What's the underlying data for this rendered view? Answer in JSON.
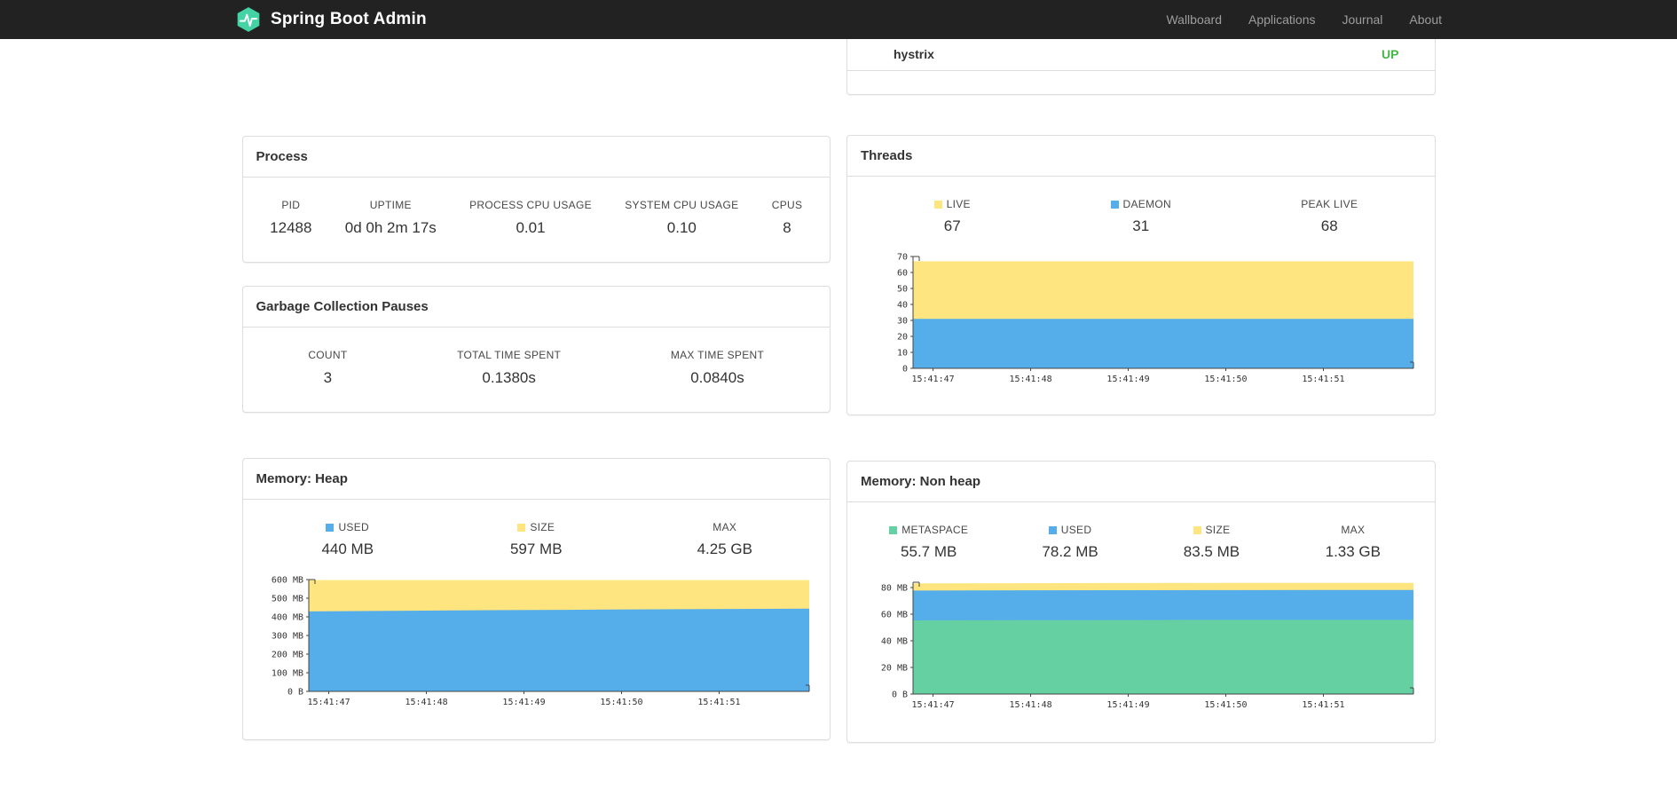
{
  "navbar": {
    "brand": "Spring Boot Admin",
    "links": [
      "Wallboard",
      "Applications",
      "Journal",
      "About"
    ]
  },
  "application": {
    "name": "hystrix",
    "status": "UP",
    "status_color": "#47b747"
  },
  "process": {
    "title": "Process",
    "metrics": [
      {
        "label": "PID",
        "value": "12488"
      },
      {
        "label": "UPTIME",
        "value": "0d 0h 2m 17s"
      },
      {
        "label": "PROCESS CPU USAGE",
        "value": "0.01"
      },
      {
        "label": "SYSTEM CPU USAGE",
        "value": "0.10"
      },
      {
        "label": "CPUS",
        "value": "8"
      }
    ]
  },
  "gc": {
    "title": "Garbage Collection Pauses",
    "metrics": [
      {
        "label": "COUNT",
        "value": "3"
      },
      {
        "label": "TOTAL TIME SPENT",
        "value": "0.1380s"
      },
      {
        "label": "MAX TIME SPENT",
        "value": "0.0840s"
      }
    ]
  },
  "threads": {
    "title": "Threads",
    "legend": [
      {
        "label": "LIVE",
        "value": "67",
        "color": "#ffe57f"
      },
      {
        "label": "DAEMON",
        "value": "31",
        "color": "#55aeea"
      },
      {
        "label": "PEAK LIVE",
        "value": "68"
      }
    ],
    "chart": {
      "type": "area",
      "ymax": 70,
      "yticks": [
        {
          "v": 0,
          "label": "0"
        },
        {
          "v": 10,
          "label": "10"
        },
        {
          "v": 20,
          "label": "20"
        },
        {
          "v": 30,
          "label": "30"
        },
        {
          "v": 40,
          "label": "40"
        },
        {
          "v": 50,
          "label": "50"
        },
        {
          "v": 60,
          "label": "60"
        },
        {
          "v": 70,
          "label": "70"
        }
      ],
      "xticks": [
        "15:41:47",
        "15:41:48",
        "15:41:49",
        "15:41:50",
        "15:41:51"
      ],
      "series": [
        {
          "name": "LIVE",
          "color": "#ffe57f",
          "values": [
            67,
            67,
            67,
            67,
            67,
            67
          ]
        },
        {
          "name": "DAEMON",
          "color": "#55aeea",
          "values": [
            31,
            31,
            31,
            31,
            31,
            31
          ]
        }
      ]
    }
  },
  "heap": {
    "title": "Memory: Heap",
    "legend": [
      {
        "label": "USED",
        "value": "440 MB",
        "color": "#55aeea"
      },
      {
        "label": "SIZE",
        "value": "597 MB",
        "color": "#ffe57f"
      },
      {
        "label": "MAX",
        "value": "4.25 GB"
      }
    ],
    "chart": {
      "type": "area",
      "ymax": 600,
      "yticks": [
        {
          "v": 0,
          "label": "0 B"
        },
        {
          "v": 100,
          "label": "100 MB"
        },
        {
          "v": 200,
          "label": "200 MB"
        },
        {
          "v": 300,
          "label": "300 MB"
        },
        {
          "v": 400,
          "label": "400 MB"
        },
        {
          "v": 500,
          "label": "500 MB"
        },
        {
          "v": 600,
          "label": "600 MB"
        }
      ],
      "xticks": [
        "15:41:47",
        "15:41:48",
        "15:41:49",
        "15:41:50",
        "15:41:51"
      ],
      "series": [
        {
          "name": "SIZE",
          "color": "#ffe57f",
          "values": [
            597,
            597,
            597,
            597,
            597,
            597
          ]
        },
        {
          "name": "USED",
          "color": "#55aeea",
          "values": [
            429,
            433,
            436,
            439,
            442,
            444
          ]
        }
      ]
    }
  },
  "nonheap": {
    "title": "Memory: Non heap",
    "legend": [
      {
        "label": "METASPACE",
        "value": "55.7 MB",
        "color": "#65d1a3"
      },
      {
        "label": "USED",
        "value": "78.2 MB",
        "color": "#55aeea"
      },
      {
        "label": "SIZE",
        "value": "83.5 MB",
        "color": "#ffe57f"
      },
      {
        "label": "MAX",
        "value": "1.33 GB"
      }
    ],
    "chart": {
      "type": "area",
      "ymax": 84,
      "yticks": [
        {
          "v": 0,
          "label": "0 B"
        },
        {
          "v": 20,
          "label": "20 MB"
        },
        {
          "v": 40,
          "label": "40 MB"
        },
        {
          "v": 60,
          "label": "60 MB"
        },
        {
          "v": 80,
          "label": "80 MB"
        }
      ],
      "xticks": [
        "15:41:47",
        "15:41:48",
        "15:41:49",
        "15:41:50",
        "15:41:51"
      ],
      "series": [
        {
          "name": "SIZE",
          "color": "#ffe57f",
          "values": [
            83.2,
            83.3,
            83.4,
            83.5,
            83.5,
            83.5
          ]
        },
        {
          "name": "USED",
          "color": "#55aeea",
          "values": [
            77.7,
            77.9,
            78.0,
            78.1,
            78.2,
            78.2
          ]
        },
        {
          "name": "METASPACE",
          "color": "#65d1a3",
          "values": [
            55.3,
            55.5,
            55.6,
            55.7,
            55.7,
            55.7
          ]
        }
      ]
    }
  }
}
